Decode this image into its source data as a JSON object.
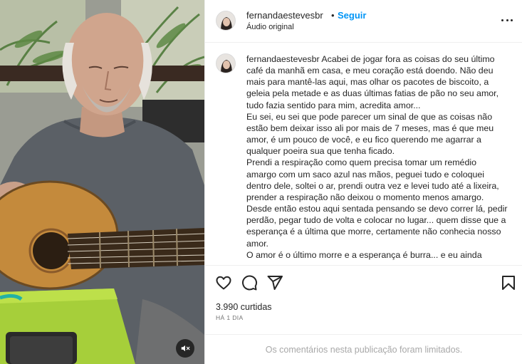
{
  "header": {
    "username": "fernandaestevesbr",
    "separator": "•",
    "follow_label": "Seguir",
    "subtitle": "Áudio original"
  },
  "caption": {
    "username": "fernandaestevesbr",
    "text": "Acabei de jogar fora as coisas do seu último café da manhã em casa, e meu coração está doendo. Não deu mais para mantê-las aqui, mas olhar os pacotes de biscoito, a geleia pela metade e as duas últimas fatias de pão no seu amor, tudo fazia sentido para mim, acredita amor...\nEu sei, eu sei que pode parecer um sinal de que as coisas não estão bem deixar isso ali por mais de 7 meses, mas é que meu amor, é um pouco de você, e eu fico querendo me agarrar a qualquer poeira sua que tenha ficado.\nPrendi a respiração como quem precisa tomar um remédio amargo com um saco azul nas mãos, peguei tudo e coloquei dentro dele, soltei o ar, prendi outra vez e levei tudo até a lixeira, prender a respiração não deixou o momento menos amargo. Desde então estou aqui sentada pensando se devo correr lá, pedir perdão, pegar tudo de volta e colocar no lugar... quem disse que a esperança é a última que morre, certamente não conhecia nosso amor.\nO amor é o último morre e a esperança é burra... e eu ainda"
  },
  "actions": {
    "like_icon": "heart-icon",
    "comment_icon": "comment-icon",
    "share_icon": "send-icon",
    "save_icon": "bookmark-icon"
  },
  "likes": "3.990 curtidas",
  "time": "HÁ 1 DIA",
  "comments_limited": "Os comentários nesta publicação foram limitados.",
  "media": {
    "mute_icon": "speaker-muted-icon"
  }
}
